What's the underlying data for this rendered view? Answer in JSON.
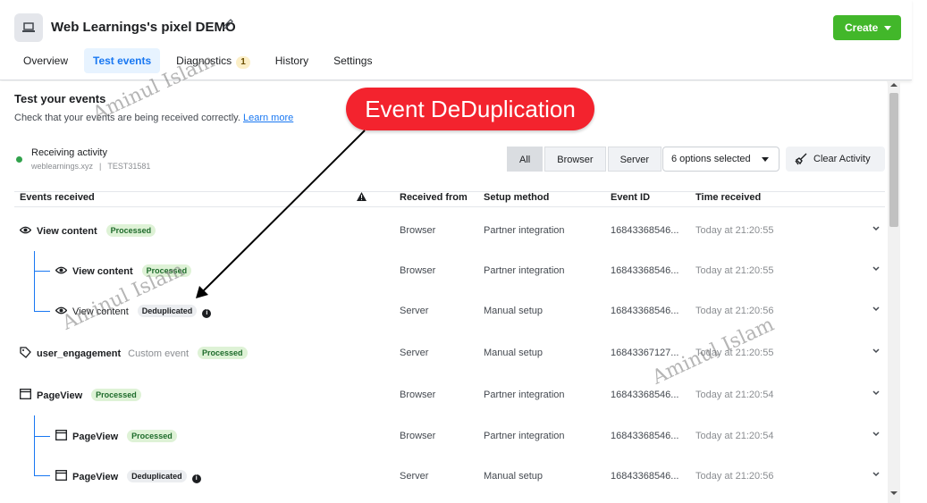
{
  "header": {
    "title": "Web Learnings's pixel DEMO",
    "create_label": "Create",
    "tabs": [
      {
        "label": "Overview"
      },
      {
        "label": "Test events"
      },
      {
        "label": "Diagnostics",
        "count": "1"
      },
      {
        "label": "History"
      },
      {
        "label": "Settings"
      }
    ]
  },
  "section": {
    "title": "Test your events",
    "subtitle": "Check that your events are being received correctly.",
    "learn_more": "Learn more"
  },
  "activity": {
    "label": "Receiving activity",
    "domain": "weblearnings.xyz",
    "separator": "|",
    "test_code": "TEST31581"
  },
  "filters": {
    "segments": [
      "All",
      "Browser",
      "Server"
    ],
    "selected_segment": "All",
    "options_label": "6 options selected",
    "clear_label": "Clear Activity"
  },
  "table": {
    "headers": {
      "events": "Events received",
      "received_from": "Received from",
      "setup": "Setup method",
      "event_id": "Event ID",
      "time": "Time received"
    },
    "rows": [
      {
        "name": "View content",
        "status": "Processed",
        "source": "Browser",
        "setup": "Partner integration",
        "event_id": "16843368546...",
        "time": "Today at 21:20:55"
      },
      {
        "name": "View content",
        "status": "Processed",
        "source": "Browser",
        "setup": "Partner integration",
        "event_id": "16843368546...",
        "time": "Today at 21:20:55"
      },
      {
        "name": "View content",
        "status": "Deduplicated",
        "source": "Server",
        "setup": "Manual setup",
        "event_id": "16843368546...",
        "time": "Today at 21:20:56"
      },
      {
        "name": "user_engagement",
        "custom": "Custom event",
        "status": "Processed",
        "source": "Server",
        "setup": "Manual setup",
        "event_id": "16843367127...",
        "time": "Today at 21:20:55"
      },
      {
        "name": "PageView",
        "status": "Processed",
        "source": "Browser",
        "setup": "Partner integration",
        "event_id": "16843368546...",
        "time": "Today at 21:20:54"
      },
      {
        "name": "PageView",
        "status": "Processed",
        "source": "Browser",
        "setup": "Partner integration",
        "event_id": "16843368546...",
        "time": "Today at 21:20:54"
      },
      {
        "name": "PageView",
        "status": "Deduplicated",
        "source": "Server",
        "setup": "Manual setup",
        "event_id": "16843368546...",
        "time": "Today at 21:20:56"
      }
    ]
  },
  "annotation": {
    "callout": "Event DeDuplication",
    "watermark": "Aminul Islam"
  },
  "colors": {
    "accent": "#1877f2",
    "create": "#42b72a",
    "callout": "#f3232e",
    "processed_bg": "#def2d6"
  }
}
